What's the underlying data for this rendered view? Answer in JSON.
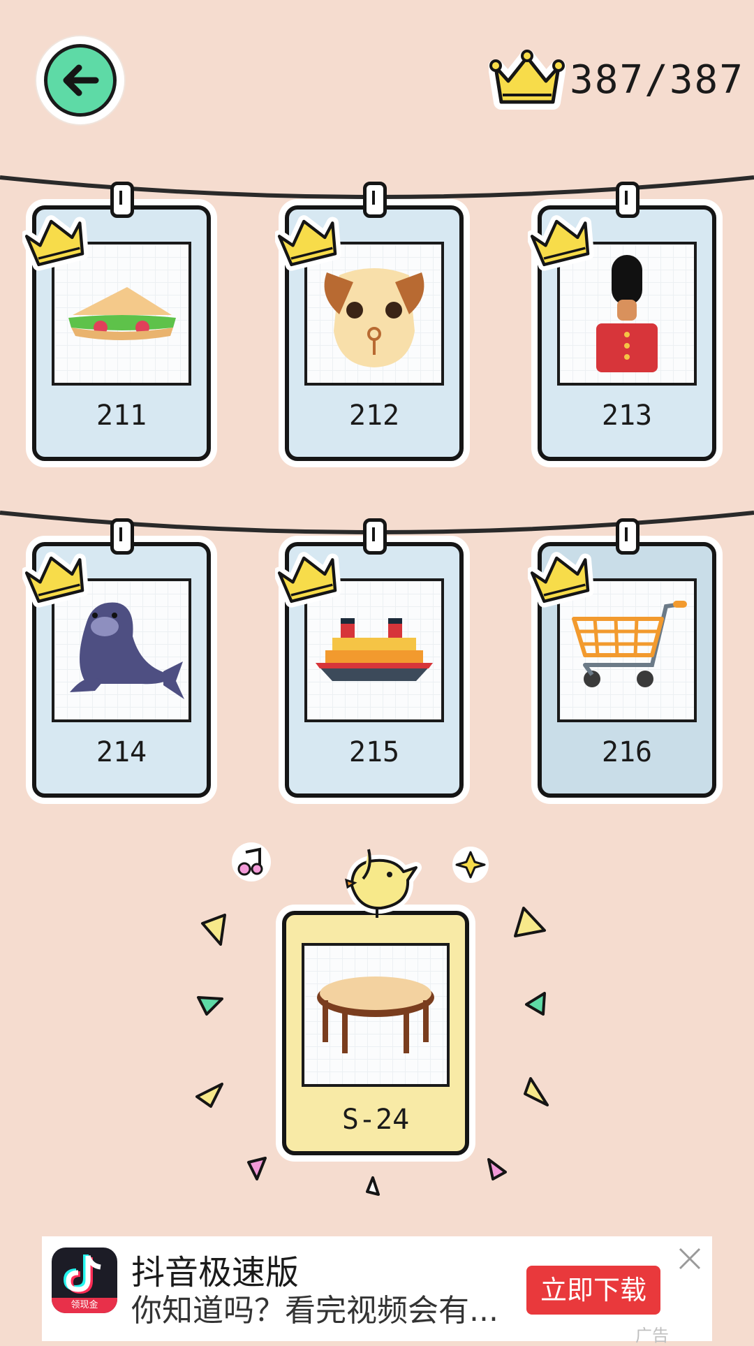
{
  "header": {
    "back_icon": "back-arrow-icon",
    "score_icon": "crown-icon",
    "score_text": "387/387",
    "accent_green": "#5edaa6",
    "crown_color": "#f7dc4a"
  },
  "levels": [
    {
      "number": "211",
      "picture": "sandwich-icon",
      "completed": true
    },
    {
      "number": "212",
      "picture": "dog-face-icon",
      "completed": true
    },
    {
      "number": "213",
      "picture": "royal-guard-icon",
      "completed": true
    },
    {
      "number": "214",
      "picture": "walrus-icon",
      "completed": true
    },
    {
      "number": "215",
      "picture": "ship-icon",
      "completed": true
    },
    {
      "number": "216",
      "picture": "shopping-cart-icon",
      "completed": true
    }
  ],
  "special_level": {
    "number": "S-24",
    "picture": "round-table-icon",
    "decoration": [
      "bird-icon",
      "music-note-icon",
      "sparkle-icon"
    ],
    "background": "#f8eaa6"
  },
  "ad": {
    "app_name": "抖音极速版",
    "logo_badge": "领现金",
    "description": "你知道吗？看完视频会有...",
    "cta": "立即下载",
    "tag": "广告",
    "cta_color": "#e9393c"
  }
}
